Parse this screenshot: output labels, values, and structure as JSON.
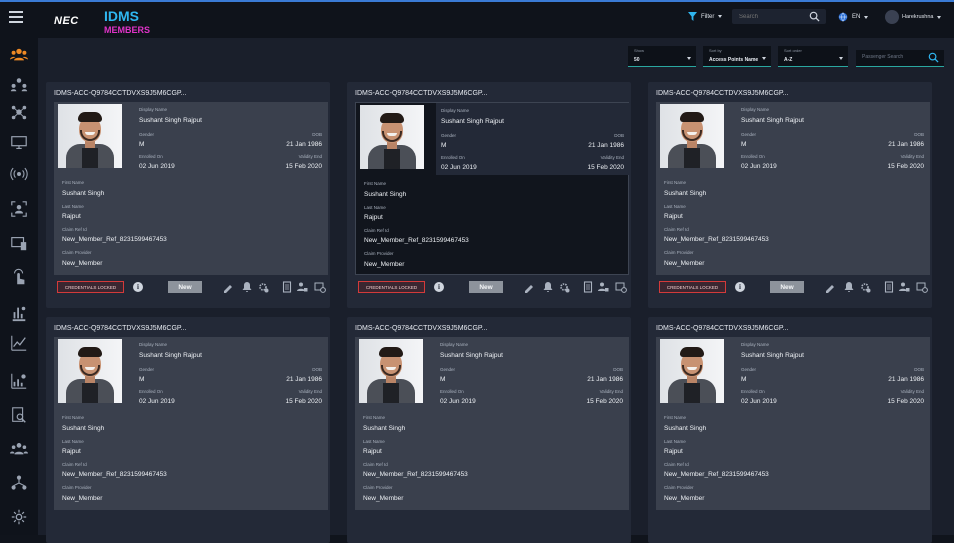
{
  "header": {
    "logo": "NEC",
    "app_title": "IDMS",
    "app_subtitle": "MEMBERS",
    "filter_label": "Filter",
    "search_placeholder": "Search",
    "language": "EN",
    "user_name": "Harekrushna"
  },
  "sidebar": {
    "icons": [
      "members-icon",
      "group-icon",
      "network-icon",
      "monitor-icon",
      "access-point-icon",
      "scan-icon",
      "device-icon",
      "touch-icon",
      "report-icon",
      "line-chart-icon",
      "bar-chart-icon",
      "search-doc-icon",
      "team-icon",
      "hierarchy-icon",
      "settings-network-icon"
    ],
    "active_index": 0
  },
  "filters": {
    "show": {
      "label": "Show",
      "value": "50"
    },
    "sort_by": {
      "label": "Sort by",
      "value": "Access Points Name"
    },
    "sort_order": {
      "label": "Sort order",
      "value": "A-Z"
    },
    "passenger_search_placeholder": "Passenger Search"
  },
  "labels": {
    "display_name": "Display Name",
    "gender": "Gender",
    "dob": "DOB",
    "enrolled_on": "Enrolled On",
    "validity_end": "Validity End",
    "first_name": "First Name",
    "last_name": "Last Name",
    "claim_ref_id": "Claim Ref Id",
    "claim_provider": "Claim Provider",
    "credentials_locked": "CREDENTIALS LOCKED",
    "new_button": "New"
  },
  "cards": [
    {
      "id": "IDMS-ACC-Q9784CCTDVXS9J5M6CGP...",
      "display_name": "Sushant Singh Rajput",
      "gender": "M",
      "dob": "21 Jan 1986",
      "enrolled_on": "02 Jun 2019",
      "validity_end": "15 Feb 2020",
      "first_name": "Sushant Singh",
      "last_name": "Rajput",
      "claim_ref_id": "New_Member_Ref_8231599467453",
      "claim_provider": "New_Member"
    },
    {
      "id": "IDMS-ACC-Q9784CCTDVXS9J5M6CGP...",
      "display_name": "Sushant Singh Rajput",
      "gender": "M",
      "dob": "21 Jan 1986",
      "enrolled_on": "02 Jun 2019",
      "validity_end": "15 Feb 2020",
      "first_name": "Sushant Singh",
      "last_name": "Rajput",
      "claim_ref_id": "New_Member_Ref_8231599467453",
      "claim_provider": "New_Member",
      "selected": true
    },
    {
      "id": "IDMS-ACC-Q9784CCTDVXS9J5M6CGP...",
      "display_name": "Sushant Singh Rajput",
      "gender": "M",
      "dob": "21 Jan 1986",
      "enrolled_on": "02 Jun 2019",
      "validity_end": "15 Feb 2020",
      "first_name": "Sushant Singh",
      "last_name": "Rajput",
      "claim_ref_id": "New_Member_Ref_8231599467453",
      "claim_provider": "New_Member"
    },
    {
      "id": "IDMS-ACC-Q9784CCTDVXS9J5M6CGP...",
      "display_name": "Sushant Singh Rajput",
      "gender": "M",
      "dob": "21 Jan 1986",
      "enrolled_on": "02 Jun 2019",
      "validity_end": "15 Feb 2020",
      "first_name": "Sushant Singh",
      "last_name": "Rajput",
      "claim_ref_id": "New_Member_Ref_8231599467453",
      "claim_provider": "New_Member"
    },
    {
      "id": "IDMS-ACC-Q9784CCTDVXS9J5M6CGP...",
      "display_name": "Sushant Singh Rajput",
      "gender": "M",
      "dob": "21 Jan 1986",
      "enrolled_on": "02 Jun 2019",
      "validity_end": "15 Feb 2020",
      "first_name": "Sushant Singh",
      "last_name": "Rajput",
      "claim_ref_id": "New_Member_Ref_8231599467453",
      "claim_provider": "New_Member"
    },
    {
      "id": "IDMS-ACC-Q9784CCTDVXS9J5M6CGP...",
      "display_name": "Sushant Singh Rajput",
      "gender": "M",
      "dob": "21 Jan 1986",
      "enrolled_on": "02 Jun 2019",
      "validity_end": "15 Feb 2020",
      "first_name": "Sushant Singh",
      "last_name": "Rajput",
      "claim_ref_id": "New_Member_Ref_8231599467453",
      "claim_provider": "New_Member"
    }
  ],
  "card_actions": [
    "edit-icon",
    "bell-icon",
    "gear-alert-icon",
    "document-icon",
    "user-lock-icon",
    "history-icon"
  ],
  "colors": {
    "accent_blue": "#2fb6f0",
    "accent_magenta": "#e033c8",
    "teal_underline": "#2aa7a0",
    "locked_red": "#d33a3a"
  }
}
